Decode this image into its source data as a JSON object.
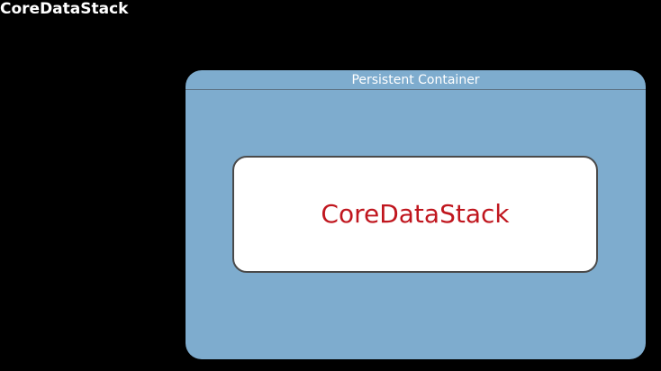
{
  "slide": {
    "title": "CoreDataStack"
  },
  "container": {
    "label": "Persistent Container",
    "fill_color": "#7eacce"
  },
  "inner": {
    "label": "CoreDataStack",
    "text_color": "#c0161e"
  }
}
